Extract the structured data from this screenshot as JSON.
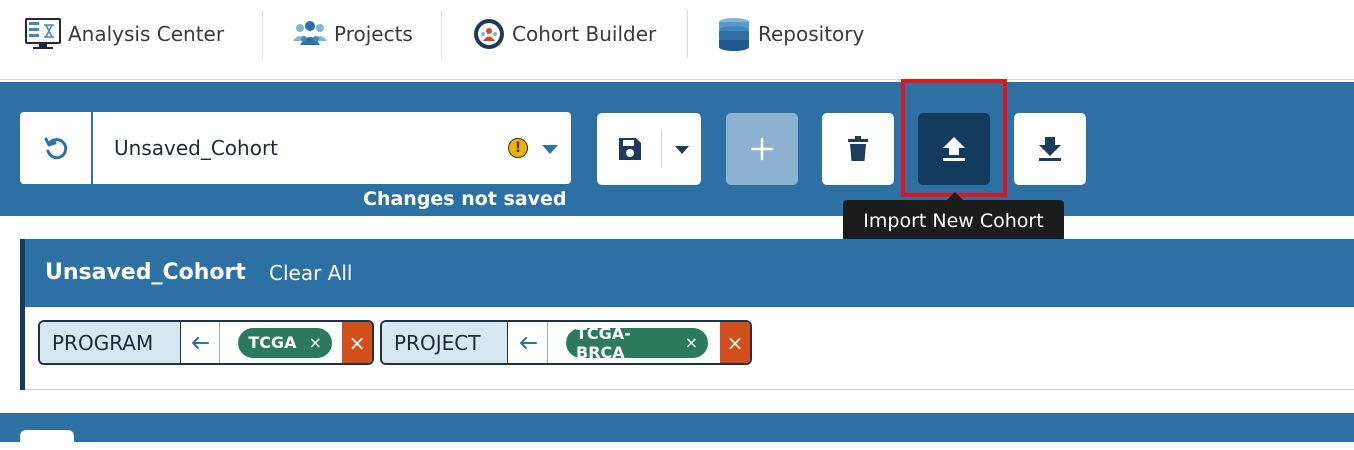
{
  "nav": {
    "items": [
      {
        "label": "Analysis Center",
        "icon": "analysis-monitor-icon"
      },
      {
        "label": "Projects",
        "icon": "people-group-icon"
      },
      {
        "label": "Cohort Builder",
        "icon": "cohort-builder-icon"
      },
      {
        "label": "Repository",
        "icon": "database-stack-icon"
      }
    ]
  },
  "toolbar": {
    "cohort_name": "Unsaved_Cohort",
    "changes_note": "Changes not saved",
    "tooltip": "Import New Cohort",
    "colors": {
      "band": "#2c70a4",
      "active_button": "#123b5e",
      "highlight": "#e0161c"
    }
  },
  "query": {
    "title": "Unsaved_Cohort",
    "clear_all": "Clear All",
    "filters": [
      {
        "field": "PROGRAM",
        "operator_icon": "arrow-left-icon",
        "values": [
          {
            "label": "TCGA",
            "remove": "×"
          }
        ],
        "remove": "×"
      },
      {
        "field": "PROJECT",
        "operator_icon": "arrow-left-icon",
        "values": [
          {
            "label": "TCGA-BRCA",
            "remove": "×"
          }
        ],
        "remove": "×"
      }
    ]
  }
}
